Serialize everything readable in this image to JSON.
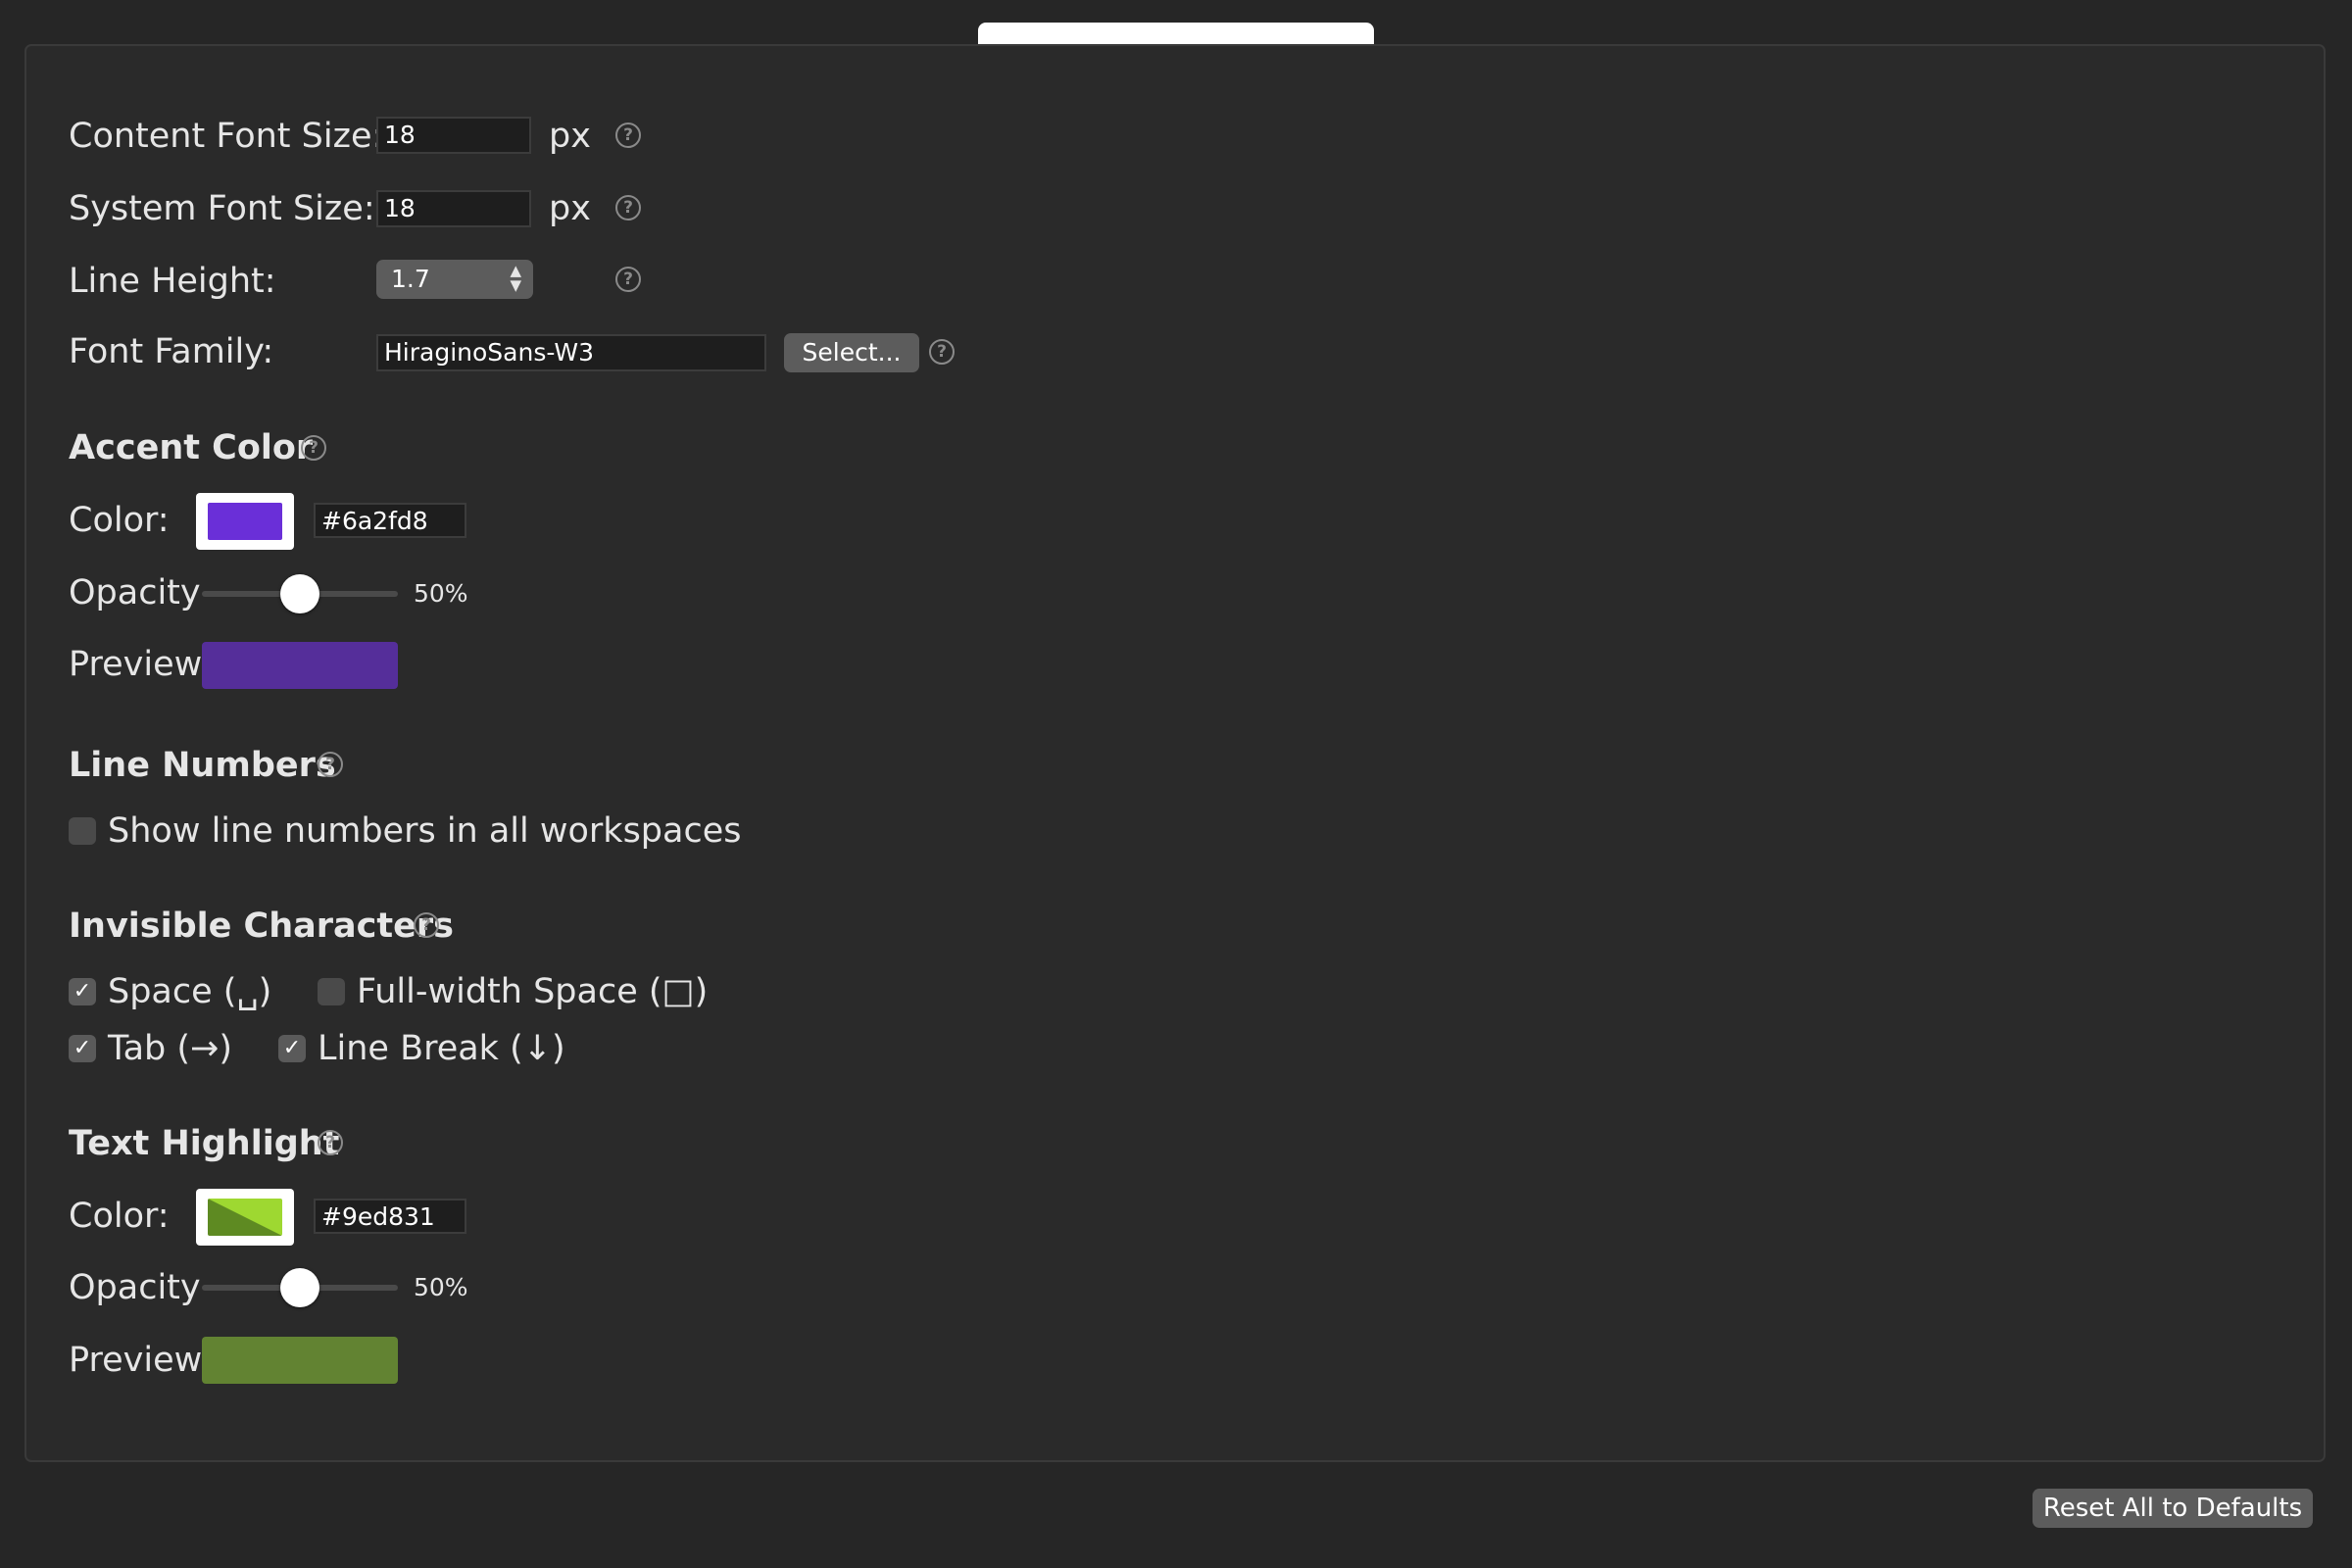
{
  "header": {
    "tab_title": ""
  },
  "font": {
    "content_size_label": "Content Font Size:",
    "content_size_value": "18",
    "system_size_label": "System Font Size:",
    "system_size_value": "18",
    "unit": "px",
    "line_height_label": "Line Height:",
    "line_height_value": "1.7",
    "family_label": "Font Family:",
    "family_value": "HiraginoSans-W3",
    "select_button": "Select..."
  },
  "accent": {
    "heading": "Accent Color",
    "color_label": "Color:",
    "color_hex": "#6a2fd8",
    "opacity_label": "Opacity",
    "opacity_value": 0.5,
    "opacity_text": "50%",
    "preview_label": "Preview",
    "preview_color": "#552e9a"
  },
  "line_numbers": {
    "heading": "Line Numbers",
    "option_label": "Show line numbers in all workspaces",
    "checked": false
  },
  "invisibles": {
    "heading": "Invisible Characters",
    "space_label": "Space (␣)",
    "space_checked": true,
    "fullwidth_label": "Full-width Space (□)",
    "fullwidth_checked": false,
    "tab_label": "Tab (→)",
    "tab_checked": true,
    "linebreak_label": "Line Break (↓)",
    "linebreak_checked": true
  },
  "highlight": {
    "heading": "Text Highlight",
    "color_label": "Color:",
    "color_hex": "#9ed831",
    "swatch_dark": "#5e8a22",
    "opacity_label": "Opacity",
    "opacity_value": 0.5,
    "opacity_text": "50%",
    "preview_label": "Preview",
    "preview_color": "#628332"
  },
  "footer": {
    "reset_button": "Reset All to Defaults"
  },
  "icons": {
    "help": "help-circle-icon",
    "check": "checkmark-icon",
    "stepper": "up-down-chevron-icon"
  }
}
